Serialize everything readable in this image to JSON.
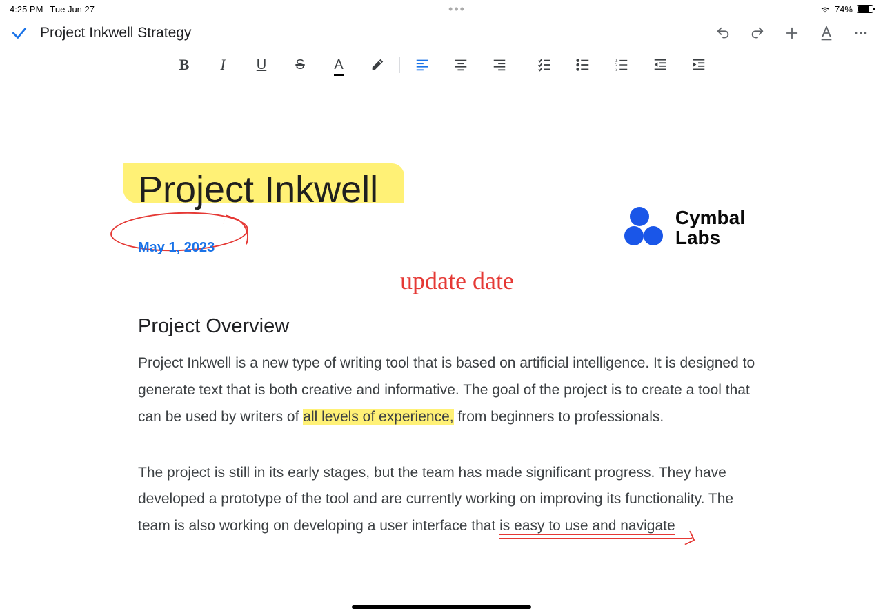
{
  "status": {
    "time": "4:25 PM",
    "date": "Tue Jun 27",
    "battery_pct": "74%"
  },
  "header": {
    "title": "Project Inkwell Strategy"
  },
  "toolbar": {
    "bold": "bold",
    "italic": "italic",
    "underline": "underline",
    "strike": "strikethrough",
    "text_color": "text-color",
    "highlight": "highlight",
    "align_left": "align-left",
    "align_center": "align-center",
    "align_right": "align-right",
    "checklist": "checklist",
    "bulleted": "bulleted-list",
    "numbered": "numbered-list",
    "outdent": "decrease-indent",
    "indent": "increase-indent"
  },
  "document": {
    "title": "Project Inkwell",
    "date": "May 1, 2023",
    "annotation_update": "update date",
    "logo_line1": "Cymbal",
    "logo_line2": "Labs",
    "section_heading": "Project Overview",
    "para1_a": "Project Inkwell is a new type of writing tool that is based on artificial intelligence. It is designed to generate text that is both creative and informative. The goal of the project is to create a tool that can be used by writers of ",
    "para1_hl": "all levels of experience,",
    "para1_b": " from beginners to professionals.",
    "para2_a": "The project is still in its early stages, but the team has made significant progress. They have developed a prototype of the tool and are currently working on improving its functionality. The team is also working on developing a user interface that ",
    "para2_u": "is easy to use and navigate"
  }
}
